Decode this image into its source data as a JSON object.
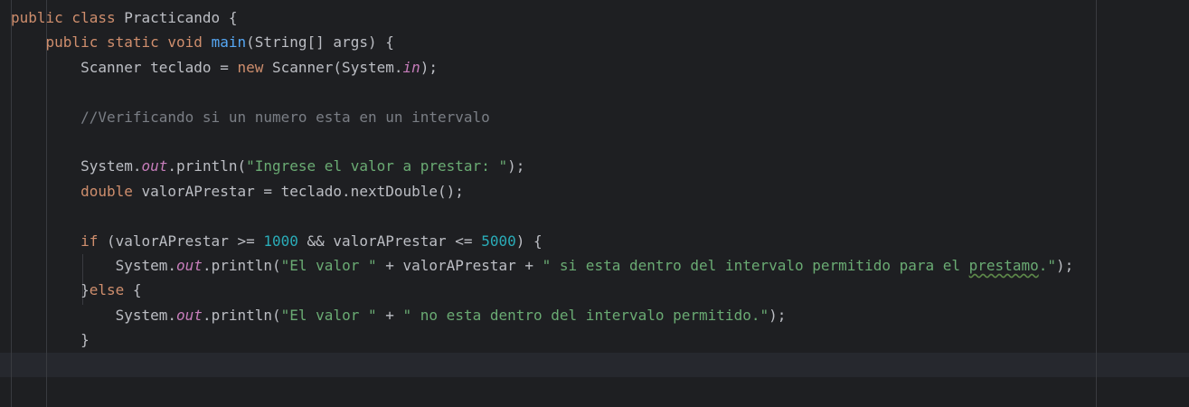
{
  "editor": {
    "colors": {
      "background": "#1e1f22",
      "keyword": "#cf8e6d",
      "method_declaration": "#56a8f5",
      "string": "#6aab73",
      "number": "#2aacb8",
      "comment": "#7a7e85",
      "static_field": "#c77dbb",
      "default_text": "#bcbec4"
    },
    "lines": [
      {
        "tokens": [
          {
            "t": "public class",
            "c": "kw"
          },
          {
            "t": " Practicando {",
            "c": ""
          }
        ]
      },
      {
        "tokens": [
          {
            "t": "    ",
            "c": ""
          },
          {
            "t": "public static void",
            "c": "kw"
          },
          {
            "t": " ",
            "c": ""
          },
          {
            "t": "main",
            "c": "fn"
          },
          {
            "t": "(String[] args) {",
            "c": ""
          }
        ]
      },
      {
        "tokens": [
          {
            "t": "        Scanner teclado = ",
            "c": ""
          },
          {
            "t": "new",
            "c": "kw"
          },
          {
            "t": " Scanner(System.",
            "c": ""
          },
          {
            "t": "in",
            "c": "fld"
          },
          {
            "t": ");",
            "c": ""
          }
        ]
      },
      {
        "tokens": [
          {
            "t": "",
            "c": ""
          }
        ]
      },
      {
        "tokens": [
          {
            "t": "        ",
            "c": ""
          },
          {
            "t": "//Verificando si un numero esta en un intervalo",
            "c": "cmt"
          }
        ]
      },
      {
        "tokens": [
          {
            "t": "",
            "c": ""
          }
        ]
      },
      {
        "tokens": [
          {
            "t": "        System.",
            "c": ""
          },
          {
            "t": "out",
            "c": "fld"
          },
          {
            "t": ".println(",
            "c": ""
          },
          {
            "t": "\"Ingrese el valor a prestar: \"",
            "c": "str"
          },
          {
            "t": ");",
            "c": ""
          }
        ]
      },
      {
        "tokens": [
          {
            "t": "        ",
            "c": ""
          },
          {
            "t": "double",
            "c": "kw"
          },
          {
            "t": " valorAPrestar = teclado.nextDouble();",
            "c": ""
          }
        ]
      },
      {
        "tokens": [
          {
            "t": "",
            "c": ""
          }
        ]
      },
      {
        "tokens": [
          {
            "t": "        ",
            "c": ""
          },
          {
            "t": "if",
            "c": "kw"
          },
          {
            "t": " (valorAPrestar >= ",
            "c": ""
          },
          {
            "t": "1000",
            "c": "num"
          },
          {
            "t": " && valorAPrestar <= ",
            "c": ""
          },
          {
            "t": "5000",
            "c": "num"
          },
          {
            "t": ") {",
            "c": ""
          }
        ]
      },
      {
        "tokens": [
          {
            "t": "            System.",
            "c": ""
          },
          {
            "t": "out",
            "c": "fld"
          },
          {
            "t": ".println(",
            "c": ""
          },
          {
            "t": "\"El valor \"",
            "c": "str"
          },
          {
            "t": " + valorAPrestar + ",
            "c": ""
          },
          {
            "t": "\" si esta dentro del intervalo permitido para el ",
            "c": "str"
          },
          {
            "t": "prestamo",
            "c": "str typo"
          },
          {
            "t": ".\"",
            "c": "str"
          },
          {
            "t": ");",
            "c": ""
          }
        ]
      },
      {
        "tokens": [
          {
            "t": "        }",
            "c": ""
          },
          {
            "t": "else",
            "c": "kw"
          },
          {
            "t": " {",
            "c": ""
          }
        ]
      },
      {
        "tokens": [
          {
            "t": "            System.",
            "c": ""
          },
          {
            "t": "out",
            "c": "fld"
          },
          {
            "t": ".println(",
            "c": ""
          },
          {
            "t": "\"El valor \"",
            "c": "str"
          },
          {
            "t": " + ",
            "c": ""
          },
          {
            "t": "\" no esta dentro del intervalo permitido.\"",
            "c": "str"
          },
          {
            "t": ");",
            "c": ""
          }
        ]
      },
      {
        "tokens": [
          {
            "t": "        }",
            "c": ""
          }
        ]
      },
      {
        "tokens": [
          {
            "t": "",
            "c": ""
          }
        ]
      }
    ]
  }
}
